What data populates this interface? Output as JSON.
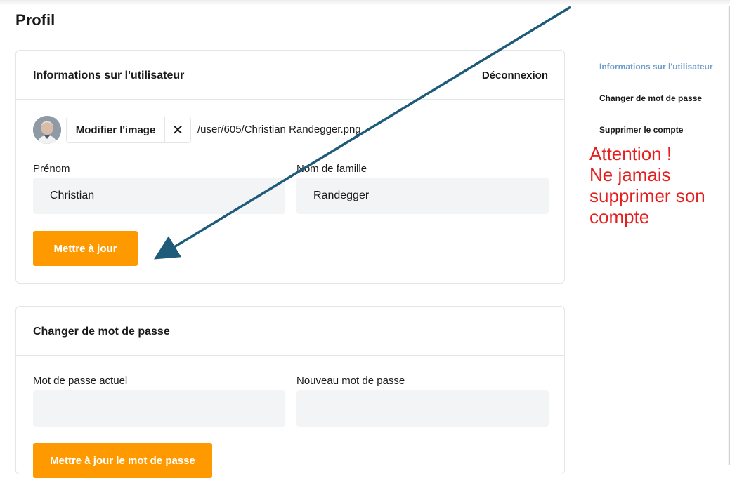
{
  "page": {
    "title": "Profil"
  },
  "user_card": {
    "title": "Informations sur l'utilisateur",
    "logout_label": "Déconnexion",
    "change_image_label": "Modifier l'image",
    "remove_image_icon": "close-icon",
    "remove_image_glyph": "✕",
    "image_path": "/user/605/Christian Randegger.png",
    "first_name_label": "Prénom",
    "first_name_value": "Christian",
    "last_name_label": "Nom de famille",
    "last_name_value": "Randegger",
    "update_label": "Mettre à jour"
  },
  "password_card": {
    "title": "Changer de mot de passe",
    "current_label": "Mot de passe actuel",
    "current_value": "",
    "new_label": "Nouveau mot de passe",
    "new_value": "",
    "update_label": "Mettre à jour le mot de passe"
  },
  "side_nav": {
    "items": [
      {
        "label": "Informations sur l'utilisateur",
        "active": true
      },
      {
        "label": "Changer de mot de passe",
        "active": false
      },
      {
        "label": "Supprimer le compte",
        "active": false
      }
    ]
  },
  "annotation": {
    "lines": [
      "Attention !",
      "Ne jamais",
      "supprimer son",
      "compte"
    ],
    "color": "#e61e1e",
    "arrow_color": "#1e5a7a"
  },
  "colors": {
    "accent": "#ff9900",
    "nav_active": "#6f9ccc",
    "input_bg": "#f3f4f6"
  }
}
